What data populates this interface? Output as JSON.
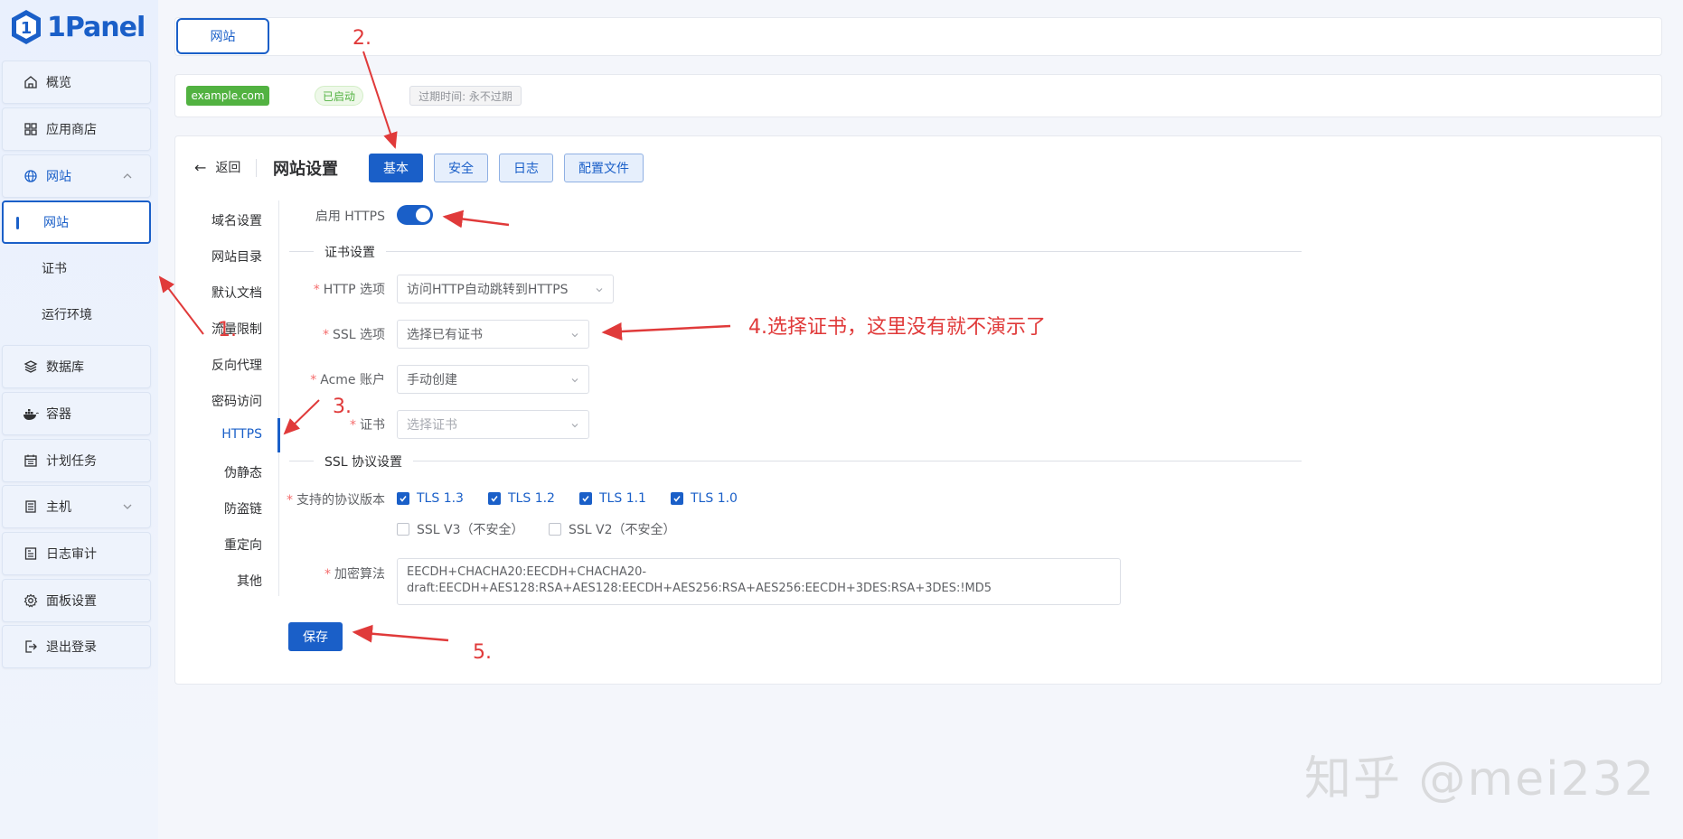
{
  "app": {
    "name": "1Panel"
  },
  "sidebar": {
    "items": [
      {
        "label": "概览",
        "icon": "home-icon"
      },
      {
        "label": "应用商店",
        "icon": "grid-icon"
      },
      {
        "label": "网站",
        "icon": "globe-icon"
      },
      {
        "label": "数据库",
        "icon": "layers-icon"
      },
      {
        "label": "容器",
        "icon": "docker-icon"
      },
      {
        "label": "计划任务",
        "icon": "calendar-icon"
      },
      {
        "label": "主机",
        "icon": "server-icon"
      },
      {
        "label": "日志审计",
        "icon": "log-icon"
      },
      {
        "label": "面板设置",
        "icon": "gear-icon"
      },
      {
        "label": "退出登录",
        "icon": "logout-icon"
      }
    ],
    "website_submenu": [
      "网站",
      "证书",
      "运行环境"
    ]
  },
  "top_tab": {
    "label": "网站"
  },
  "site_info": {
    "domain": "example.com",
    "status": "已启动",
    "expire": "过期时间: 永不过期"
  },
  "header": {
    "back_label": "返回",
    "title": "网站设置",
    "tabs": [
      "基本",
      "安全",
      "日志",
      "配置文件"
    ]
  },
  "left_nav": [
    "域名设置",
    "网站目录",
    "默认文档",
    "流量限制",
    "反向代理",
    "密码访问",
    "HTTPS",
    "伪静态",
    "防盗链",
    "重定向",
    "其他"
  ],
  "form": {
    "enable_https_label": "启用 HTTPS",
    "enable_https": true,
    "cert_section": "证书设置",
    "http_option_label": "HTTP 选项",
    "http_option_value": "访问HTTP自动跳转到HTTPS",
    "ssl_option_label": "SSL 选项",
    "ssl_option_value": "选择已有证书",
    "acme_label": "Acme 账户",
    "acme_value": "手动创建",
    "cert_label": "证书",
    "cert_placeholder": "选择证书",
    "ssl_section": "SSL 协议设置",
    "protocol_label": "支持的协议版本",
    "protocols": [
      {
        "label": "TLS 1.3",
        "checked": true
      },
      {
        "label": "TLS 1.2",
        "checked": true
      },
      {
        "label": "TLS 1.1",
        "checked": true
      },
      {
        "label": "TLS 1.0",
        "checked": true
      },
      {
        "label": "SSL V3（不安全）",
        "checked": false
      },
      {
        "label": "SSL V2（不安全）",
        "checked": false
      }
    ],
    "cipher_label": "加密算法",
    "cipher_value": "EECDH+CHACHA20:EECDH+CHACHA20-draft:EECDH+AES128:RSA+AES128:EECDH+AES256:RSA+AES256:EECDH+3DES:RSA+3DES:!MD5",
    "save_label": "保存"
  },
  "annotations": {
    "a1": "1.",
    "a2": "2.",
    "a3": "3.",
    "a4": "4.选择证书，这里没有就不演示了",
    "a5": "5."
  },
  "watermark": "知乎 @mei232",
  "colors": {
    "primary": "#1a5fc8",
    "success": "#52b241",
    "annotation": "#e03a3a"
  }
}
